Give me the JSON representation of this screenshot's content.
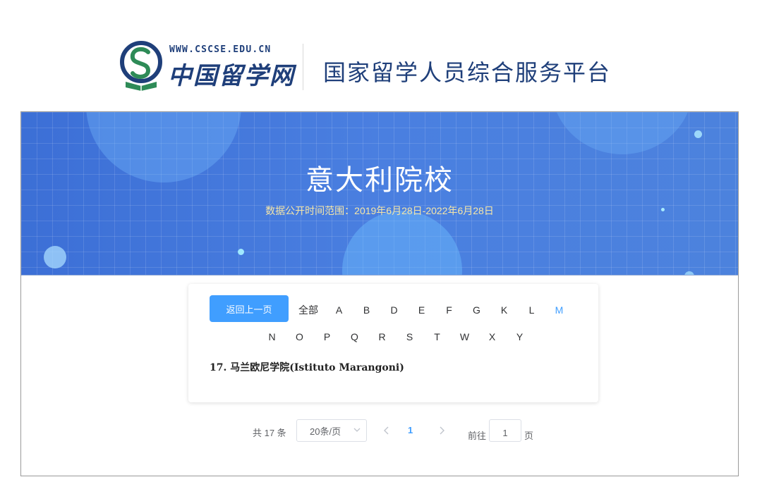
{
  "header": {
    "site_url": "WWW.CSCSE.EDU.CN",
    "site_name": "中国留学网",
    "platform_title": "国家留学人员综合服务平台"
  },
  "banner": {
    "title": "意大利院校",
    "subtitle": "数据公开时间范围：2019年6月28日-2022年6月28日"
  },
  "filter": {
    "back_label": "返回上一页",
    "all_label": "全部",
    "letters_row1": [
      "A",
      "B",
      "D",
      "E",
      "F",
      "G",
      "K",
      "L",
      "M"
    ],
    "letters_row2": [
      "N",
      "O",
      "P",
      "Q",
      "R",
      "S",
      "T",
      "W",
      "X",
      "Y"
    ],
    "active_letter": "M"
  },
  "results": [
    {
      "label": "17.  马兰欧尼学院(Istituto Marangoni)"
    }
  ],
  "pagination": {
    "total_label": "共 17 条",
    "page_size_label": "20条/页",
    "current_page": "1",
    "goto_label": "前往",
    "goto_value": "1",
    "goto_suffix": "页"
  },
  "colors": {
    "brand_navy": "#1f3f7a",
    "accent_blue": "#409eff",
    "banner_blue": "#4a7fe0",
    "subtitle_gold": "#f5e6a8"
  },
  "icons": {
    "logo": "cscse-logo-icon",
    "prev": "chevron-left-icon",
    "next": "chevron-right-icon",
    "select": "chevron-down-icon"
  }
}
